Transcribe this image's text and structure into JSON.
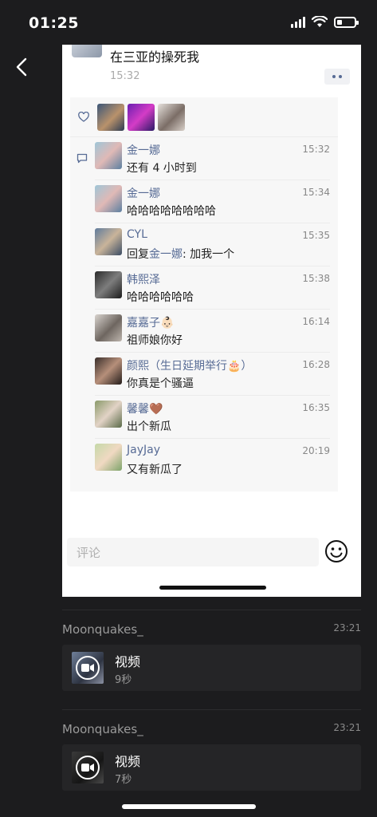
{
  "status_bar": {
    "time": "01:25"
  },
  "post": {
    "text": "在三亚的操死我",
    "time": "15:32"
  },
  "comments": [
    {
      "name": "金一娜",
      "text": "还有 4 小时到",
      "time": "15:32"
    },
    {
      "name": "金一娜",
      "text": "哈哈哈哈哈哈哈哈",
      "time": "15:34"
    },
    {
      "name": "CYL",
      "text_prefix": "回复",
      "mention": "金一娜",
      "text": ": 加我一个",
      "time": "15:35"
    },
    {
      "name": "韩熙泽",
      "text": "哈哈哈哈哈哈",
      "time": "15:38"
    },
    {
      "name": "嘉嘉子👶🏻",
      "text": "祖师娘你好",
      "time": "16:14"
    },
    {
      "name": "颜熙（生日延期举行🎂）",
      "text": "你真是个骚逼",
      "time": "16:28"
    },
    {
      "name": "馨馨🤎",
      "text": "出个新瓜",
      "time": "16:35"
    },
    {
      "name": "JayJay",
      "text": "又有新瓜了",
      "time": "20:19"
    }
  ],
  "comment_bar": {
    "placeholder": "评论"
  },
  "messages": [
    {
      "sender": "Moonquakes_",
      "time": "23:21",
      "title": "视频",
      "duration": "9秒"
    },
    {
      "sender": "Moonquakes_",
      "time": "23:21",
      "title": "视频",
      "duration": "7秒"
    }
  ],
  "colors": {
    "link": "#576b95",
    "background": "#1c1c1e",
    "bubble": "#252527"
  },
  "icons": [
    "back-chevron-icon",
    "heart-icon",
    "comment-icon",
    "emoji-icon",
    "video-play-icon",
    "wifi-icon",
    "signal-icon",
    "battery-icon"
  ]
}
